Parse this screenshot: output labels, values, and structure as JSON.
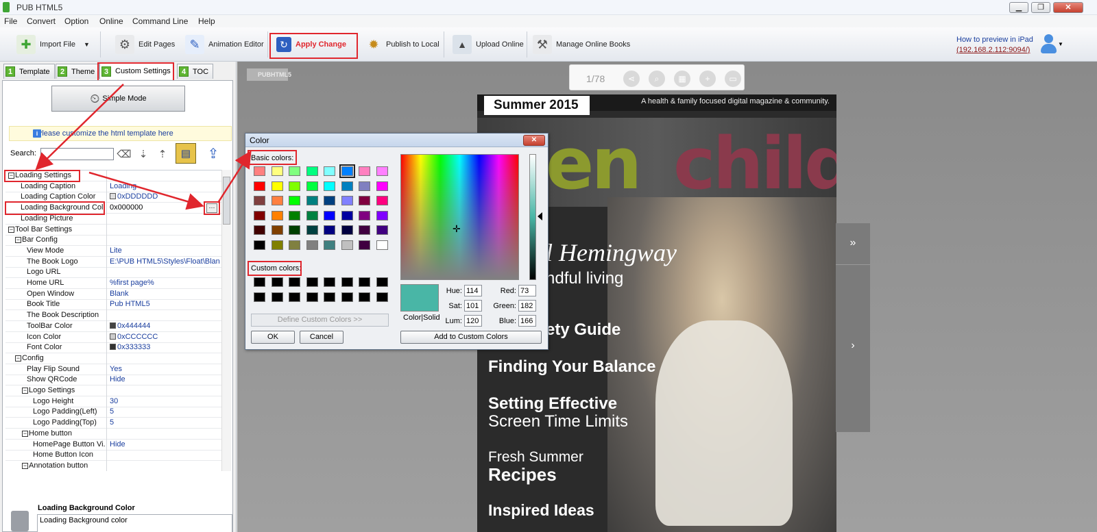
{
  "app": {
    "title": "PUB HTML5"
  },
  "window_controls": {
    "minimize": "▁",
    "maximize": "❐",
    "close": "✕"
  },
  "menu": [
    "File",
    "Convert",
    "Option",
    "Online",
    "Command Line",
    "Help"
  ],
  "toolbar": {
    "import_file": "Import File",
    "edit_pages": "Edit Pages",
    "animation_editor": "Animation Editor",
    "apply_change": "Apply Change",
    "publish_local": "Publish to Local",
    "upload_online": "Upload Online",
    "manage_books": "Manage Online Books",
    "preview_link_1": "How to preview in iPad",
    "preview_link_2": "(192.168.2.112:9094/)"
  },
  "tabs": [
    {
      "num": "1",
      "label": "Template"
    },
    {
      "num": "2",
      "label": "Theme"
    },
    {
      "num": "3",
      "label": "Custom Settings"
    },
    {
      "num": "4",
      "label": "TOC"
    }
  ],
  "panel": {
    "simple_mode": "Simple Mode",
    "info": "Please customize the html template here",
    "search_label": "Search:",
    "search_value": "",
    "desc_title": "Loading Background Color",
    "desc_text": "Loading Background color"
  },
  "settings": [
    {
      "key": "Loading Settings",
      "value": "",
      "level": 0,
      "group": true
    },
    {
      "key": "Loading Caption",
      "value": "Loading",
      "level": 1
    },
    {
      "key": "Loading Caption Color",
      "value": "0xDDDDDD",
      "level": 1,
      "swatch": "#dddddd"
    },
    {
      "key": "Loading Background Color",
      "value": "0x000000",
      "level": 1,
      "selected": true
    },
    {
      "key": "Loading Picture",
      "value": "",
      "level": 1
    },
    {
      "key": "Tool Bar Settings",
      "value": "",
      "level": 0,
      "group": true
    },
    {
      "key": "Bar Config",
      "value": "",
      "level": 1,
      "group": true
    },
    {
      "key": "View Mode",
      "value": "Lite",
      "level": 2
    },
    {
      "key": "The Book Logo",
      "value": "E:\\PUB HTML5\\Styles\\Float\\Blan...",
      "level": 2
    },
    {
      "key": "Logo URL",
      "value": "",
      "level": 2
    },
    {
      "key": "Home URL",
      "value": "%first page%",
      "level": 2
    },
    {
      "key": "Open Window",
      "value": "Blank",
      "level": 2
    },
    {
      "key": "Book Title",
      "value": "Pub HTML5",
      "level": 2
    },
    {
      "key": "The Book Description",
      "value": "",
      "level": 2
    },
    {
      "key": "ToolBar Color",
      "value": "0x444444",
      "level": 2,
      "swatch": "#444444"
    },
    {
      "key": "Icon Color",
      "value": "0xCCCCCC",
      "level": 2,
      "swatch": "#cccccc"
    },
    {
      "key": "Font Color",
      "value": "0x333333",
      "level": 2,
      "swatch": "#333333"
    },
    {
      "key": "Config",
      "value": "",
      "level": 1,
      "group": true
    },
    {
      "key": "Play Flip Sound",
      "value": "Yes",
      "level": 2
    },
    {
      "key": "Show QRCode",
      "value": "Hide",
      "level": 2
    },
    {
      "key": "Logo Settings",
      "value": "",
      "level": 2,
      "group": true
    },
    {
      "key": "Logo Height",
      "value": "30",
      "level": 3
    },
    {
      "key": "Logo Padding(Left)",
      "value": "5",
      "level": 3
    },
    {
      "key": "Logo Padding(Top)",
      "value": "5",
      "level": 3
    },
    {
      "key": "Home button",
      "value": "",
      "level": 2,
      "group": true
    },
    {
      "key": "HomePage Button Vi...",
      "value": "Hide",
      "level": 3
    },
    {
      "key": "Home Button Icon",
      "value": "",
      "level": 3
    },
    {
      "key": "Annotation button",
      "value": "",
      "level": 2,
      "group": true
    }
  ],
  "viewer": {
    "logo": "PUBHTML5",
    "page": "1/78"
  },
  "magazine": {
    "season": "Summer 2015",
    "tagline": "A health & family focused digital magazine & community.",
    "mast_1": "reen",
    "mast_2": "child",
    "line_1": "l Hemingway",
    "line_2": "ndful living",
    "line_3": "ety Guide",
    "line_4": "Finding Your Balance",
    "line_5": "Setting Effective",
    "line_6": "Screen Time Limits",
    "line_7": "Fresh Summer",
    "line_8": "Recipes",
    "line_9": "Inspired Ideas"
  },
  "dialog": {
    "title": "Color",
    "basic_colors": "Basic colors:",
    "custom_colors": "Custom colors:",
    "define_custom": "Define Custom Colors >>",
    "ok": "OK",
    "cancel": "Cancel",
    "add_custom": "Add to Custom Colors",
    "color_solid": "Color|Solid",
    "hue_label": "Hue:",
    "hue": "114",
    "sat_label": "Sat:",
    "sat": "101",
    "lum_label": "Lum:",
    "lum": "120",
    "red_label": "Red:",
    "red": "73",
    "green_label": "Green:",
    "green": "182",
    "blue_label": "Blue:",
    "blue": "166",
    "basic_palette": [
      [
        "#ff8080",
        "#ffff80",
        "#80ff80",
        "#00ff80",
        "#80ffff",
        "#0080ff",
        "#ff80c0",
        "#ff80ff"
      ],
      [
        "#ff0000",
        "#ffff00",
        "#80ff00",
        "#00ff40",
        "#00ffff",
        "#0080c0",
        "#8080c0",
        "#ff00ff"
      ],
      [
        "#804040",
        "#ff8040",
        "#00ff00",
        "#008080",
        "#004080",
        "#8080ff",
        "#800040",
        "#ff0080"
      ],
      [
        "#800000",
        "#ff8000",
        "#008000",
        "#008040",
        "#0000ff",
        "#0000a0",
        "#800080",
        "#8000ff"
      ],
      [
        "#400000",
        "#804000",
        "#004000",
        "#004040",
        "#000080",
        "#000040",
        "#400040",
        "#400080"
      ],
      [
        "#000000",
        "#808000",
        "#808040",
        "#808080",
        "#408080",
        "#c0c0c0",
        "#400040",
        "#ffffff"
      ]
    ],
    "selected_color": "#0080ff",
    "current_color": "#49b6a6"
  }
}
